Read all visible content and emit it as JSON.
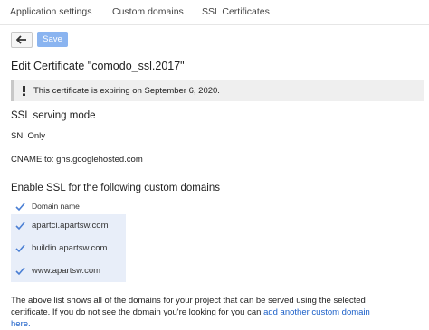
{
  "tabs": [
    "Application settings",
    "Custom domains",
    "SSL Certificates"
  ],
  "toolbar": {
    "save_label": "Save"
  },
  "page_title": "Edit Certificate \"comodo_ssl.2017\"",
  "notice": "This certificate is expiring on September 6, 2020.",
  "ssl_mode": {
    "heading": "SSL serving mode",
    "value": "SNI Only"
  },
  "cname": "CNAME to: ghs.googlehosted.com",
  "domains_section": {
    "heading": "Enable SSL for the following custom domains",
    "column_header": "Domain name",
    "rows": [
      "apartci.apartsw.com",
      "buildin.apartsw.com",
      "www.apartsw.com"
    ]
  },
  "footer": {
    "text_line1": "The above list shows all of the domains for your project that can be served using the selected",
    "text_line2": "certificate. If you do not see the domain you're looking for you can ",
    "link": "add another custom domain",
    "link_tail": "here."
  },
  "colors": {
    "save_button": "#8ab4f0",
    "row_highlight": "#e8eef9",
    "link": "#1a5fc8",
    "checkbox": "#4a7fd4"
  },
  "icons": {
    "back": "arrow-left-icon",
    "notice": "info-icon",
    "checkbox": "checkmark-icon"
  }
}
